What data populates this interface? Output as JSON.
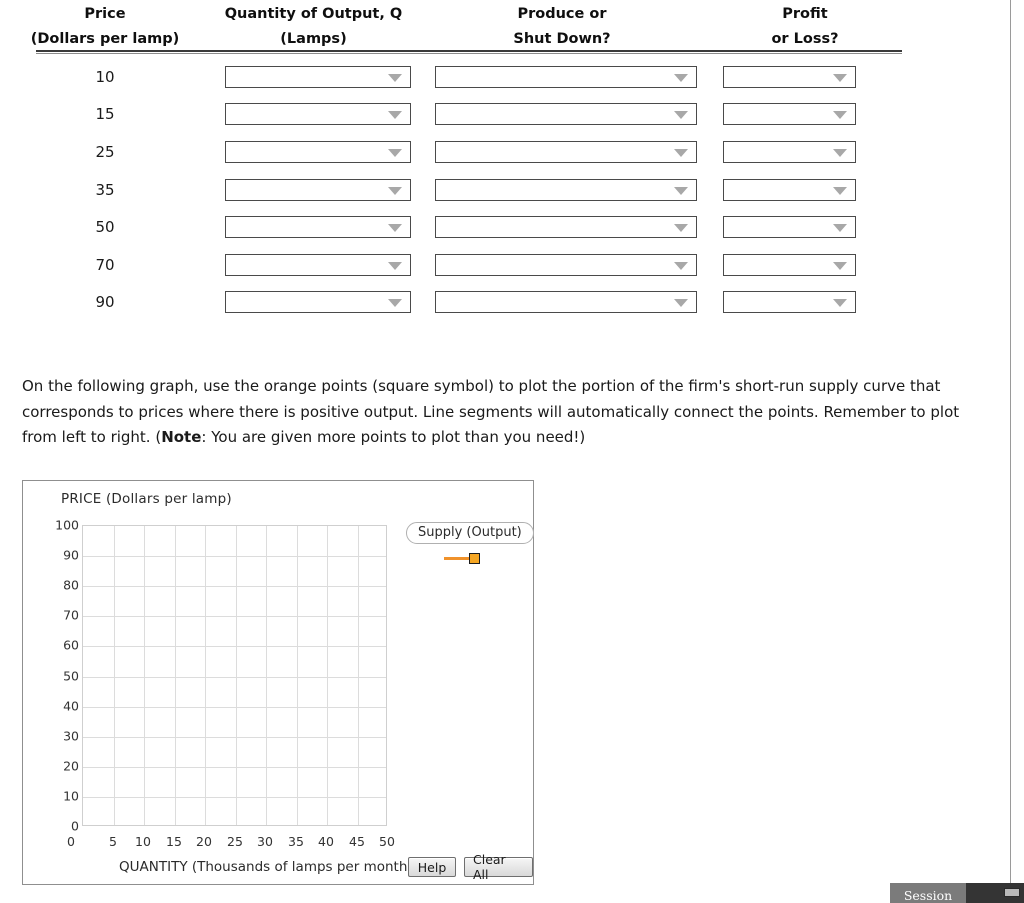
{
  "table": {
    "headers": [
      {
        "line1": "Price",
        "line2": "(Dollars per lamp)"
      },
      {
        "line1": "Quantity of Output, Q",
        "line2": "(Lamps)"
      },
      {
        "line1": "Produce or",
        "line2": "Shut Down?"
      },
      {
        "line1": "Profit",
        "line2": "or Loss?"
      }
    ],
    "rows": [
      {
        "price": "10",
        "quantity": "",
        "produce": "",
        "profit": ""
      },
      {
        "price": "15",
        "quantity": "",
        "produce": "",
        "profit": ""
      },
      {
        "price": "25",
        "quantity": "",
        "produce": "",
        "profit": ""
      },
      {
        "price": "35",
        "quantity": "",
        "produce": "",
        "profit": ""
      },
      {
        "price": "50",
        "quantity": "",
        "produce": "",
        "profit": ""
      },
      {
        "price": "70",
        "quantity": "",
        "produce": "",
        "profit": ""
      },
      {
        "price": "90",
        "quantity": "",
        "produce": "",
        "profit": ""
      }
    ]
  },
  "instructions": {
    "part1": "On the following graph, use the orange points (square symbol) to plot the portion of the firm's short-run supply curve that corresponds to prices where there is positive output. Line segments will automatically connect the points. Remember to plot from left to right. (",
    "bold": "Note",
    "part2": ": You are given more points to plot than you need!)"
  },
  "chart_data": {
    "type": "line",
    "title": "PRICE (Dollars per lamp)",
    "xlabel": "QUANTITY (Thousands of lamps per month)",
    "ylabel": "PRICE (Dollars per lamp)",
    "x_ticks": [
      "0",
      "5",
      "10",
      "15",
      "20",
      "25",
      "30",
      "35",
      "40",
      "45",
      "50"
    ],
    "y_ticks": [
      "100",
      "90",
      "80",
      "70",
      "60",
      "50",
      "40",
      "30",
      "20",
      "10",
      "0"
    ],
    "xlim": [
      0,
      50
    ],
    "ylim": [
      0,
      100
    ],
    "grid": true,
    "series": [
      {
        "name": "Supply (Output)",
        "color": "#f5a623",
        "marker": "square",
        "x": [],
        "y": []
      }
    ],
    "legend": {
      "position": "right",
      "label": "Supply (Output)"
    },
    "x_origin_label": "0"
  },
  "graph_buttons": {
    "help": "Help",
    "clear_all": "Clear All"
  },
  "session": {
    "label": "Session"
  },
  "colors": {
    "orange": "#f5a623",
    "orange_line": "#f0922b",
    "grid": "#dcdcdc",
    "panel_border": "#8f8f8f"
  }
}
